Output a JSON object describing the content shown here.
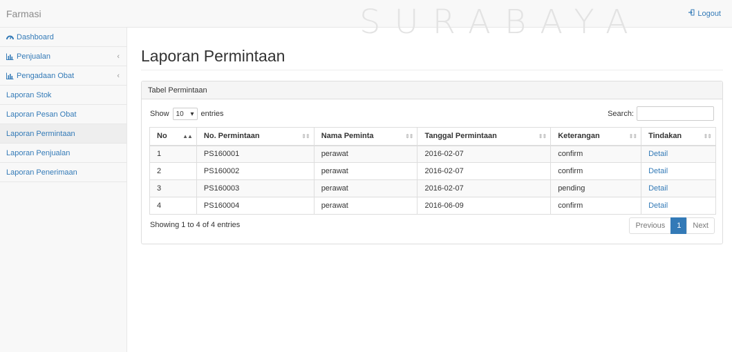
{
  "header": {
    "brand": "Farmasi",
    "logout": "Logout",
    "watermark": "SURABAYA"
  },
  "sidebar": {
    "items": [
      {
        "label": "Dashboard",
        "icon": "dashboard-icon"
      },
      {
        "label": "Penjualan",
        "icon": "bar-chart-icon",
        "chevron": "‹"
      },
      {
        "label": "Pengadaan Obat",
        "icon": "bar-chart-icon",
        "chevron": "‹"
      },
      {
        "label": "Laporan Stok"
      },
      {
        "label": "Laporan Pesan Obat"
      },
      {
        "label": "Laporan Permintaan",
        "active": true
      },
      {
        "label": "Laporan Penjualan"
      },
      {
        "label": "Laporan Penerimaan"
      }
    ]
  },
  "main": {
    "title": "Laporan Permintaan",
    "panel_title": "Tabel Permintaan",
    "show_label": "Show",
    "page_length": "10",
    "entries_label": "entries",
    "search_label": "Search:",
    "search_value": "",
    "columns": [
      "No",
      "No. Permintaan",
      "Nama Peminta",
      "Tanggal Permintaan",
      "Keterangan",
      "Tindakan"
    ],
    "rows": [
      [
        "1",
        "PS160001",
        "perawat",
        "2016-02-07",
        "confirm",
        "Detail"
      ],
      [
        "2",
        "PS160002",
        "perawat",
        "2016-02-07",
        "confirm",
        "Detail"
      ],
      [
        "3",
        "PS160003",
        "perawat",
        "2016-02-07",
        "pending",
        "Detail"
      ],
      [
        "4",
        "PS160004",
        "perawat",
        "2016-06-09",
        "confirm",
        "Detail"
      ]
    ],
    "info": "Showing 1 to 4 of 4 entries",
    "pager": {
      "previous": "Previous",
      "current": "1",
      "next": "Next"
    }
  },
  "colors": {
    "link": "#337ab7",
    "sidebar_bg": "#f8f8f8",
    "active_item_bg": "#eeeeee"
  }
}
